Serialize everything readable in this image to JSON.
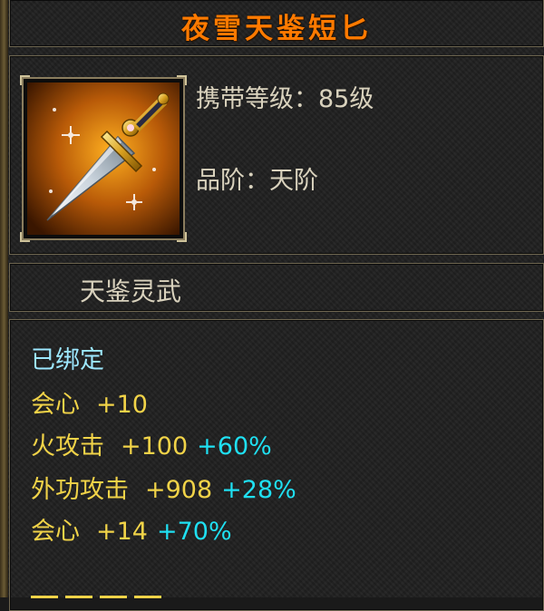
{
  "item": {
    "name": "夜雪天鉴短匕",
    "level_label": "携带等级：85级",
    "grade_label": "品阶：天阶",
    "category": "天鉴灵武",
    "icon": "dagger-icon"
  },
  "stats": {
    "bound": "已绑定",
    "lines": [
      {
        "name": "会心",
        "value": "+10",
        "pct": ""
      },
      {
        "name": "火攻击",
        "value": "+100",
        "pct": "+60%"
      },
      {
        "name": "外功攻击",
        "value": "+908",
        "pct": "+28%"
      },
      {
        "name": "会心",
        "value": "+14",
        "pct": "+70%"
      }
    ]
  },
  "colors": {
    "title": "#ff7a00",
    "stat_name": "#f1d348",
    "percent": "#1fe0f2",
    "bound": "#9de8ff",
    "text": "#d9d2bd"
  }
}
